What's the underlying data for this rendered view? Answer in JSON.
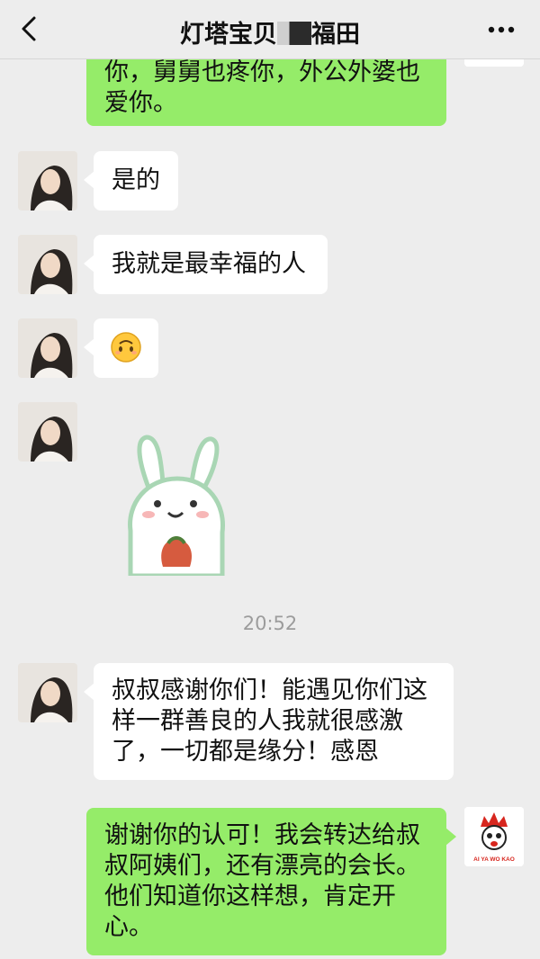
{
  "header": {
    "title_part1": "灯塔宝贝",
    "title_part2": "福田",
    "back_icon": "chevron-left-icon",
    "more_icon": "ellipsis-icon"
  },
  "messages": [
    {
      "side": "right",
      "text": "你，舅舅也疼你，外公外婆也爱你。",
      "type": "text"
    },
    {
      "side": "left",
      "text": "是的",
      "type": "text"
    },
    {
      "side": "left",
      "text": "我就是最幸福的人",
      "type": "text"
    },
    {
      "side": "left",
      "text": "🙃",
      "type": "emoji"
    },
    {
      "side": "left",
      "type": "sticker",
      "sticker": "bunny-sticker"
    },
    {
      "side": "left",
      "text": "叔叔感谢你们！能遇见你们这样一群善良的人我就很感激了，一切都是缘分！感恩",
      "type": "text"
    },
    {
      "side": "right",
      "text": "谢谢你的认可！我会转达给叔叔阿姨们，还有漂亮的会长。他们知道你这样想，肯定开心。",
      "type": "text"
    }
  ],
  "timestamp": "20:52",
  "logo_text": "AI YA WO KAO",
  "colors": {
    "bubble_green": "#95ec69",
    "bubble_white": "#ffffff",
    "background": "#ededed"
  }
}
